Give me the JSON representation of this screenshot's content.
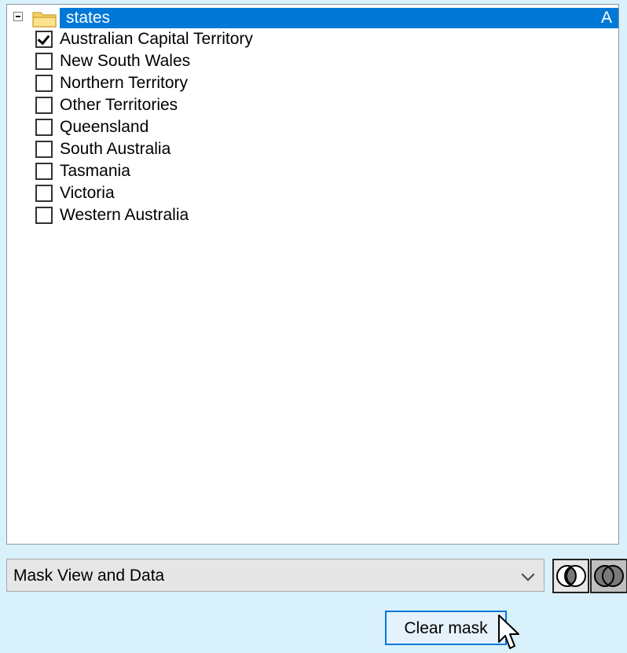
{
  "tree": {
    "root": {
      "label": "states",
      "sort_indicator": "A",
      "expanded": true
    },
    "items": [
      {
        "label": "Australian Capital Territory",
        "checked": true
      },
      {
        "label": "New South Wales",
        "checked": false
      },
      {
        "label": "Northern Territory",
        "checked": false
      },
      {
        "label": "Other Territories",
        "checked": false
      },
      {
        "label": "Queensland",
        "checked": false
      },
      {
        "label": "South Australia",
        "checked": false
      },
      {
        "label": "Tasmania",
        "checked": false
      },
      {
        "label": "Victoria",
        "checked": false
      },
      {
        "label": "Western Australia",
        "checked": false
      }
    ]
  },
  "mask_mode": {
    "selected": "Mask View and Data"
  },
  "venn_buttons": [
    {
      "icon": "venn-overlap-icon",
      "active": false
    },
    {
      "icon": "venn-union-icon",
      "active": true
    }
  ],
  "clear_mask": {
    "label": "Clear mask"
  },
  "colors": {
    "selection": "#0078d7",
    "background": "#d9f1fa",
    "folder": "#f5c74a"
  }
}
